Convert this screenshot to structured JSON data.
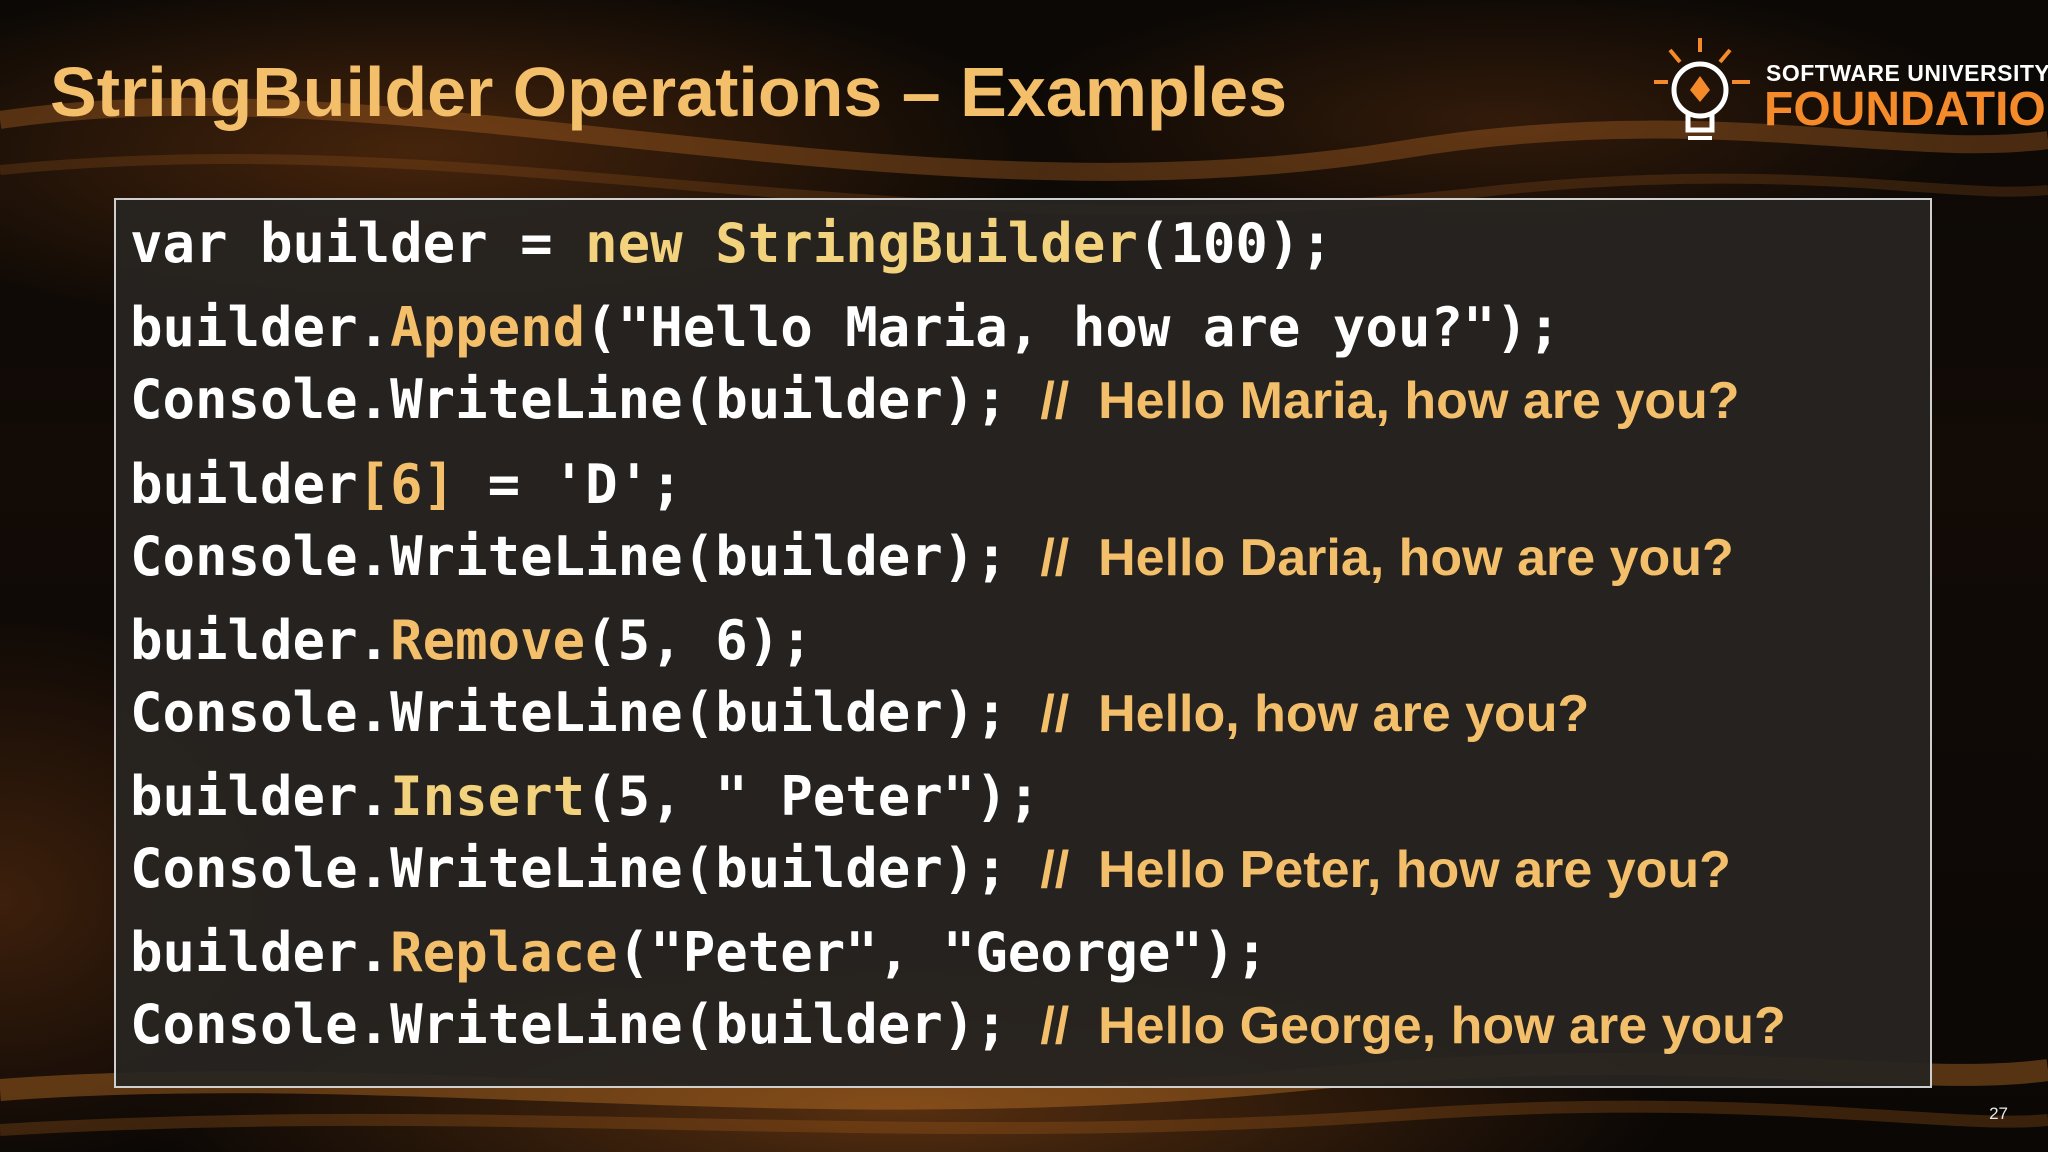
{
  "slide": {
    "title": "StringBuilder Operations – Examples",
    "page_number": "27"
  },
  "logo": {
    "line1": "SOFTWARE UNIVERSITY",
    "line2": "FOUNDATION"
  },
  "code": {
    "l1": {
      "a": "var builder = ",
      "b": "new StringBuilder",
      "c": "(100);"
    },
    "l2": {
      "a": "builder.",
      "b": "Append",
      "c": "(\"Hello Maria, how are you?\");"
    },
    "l3": {
      "a": "Console.WriteLine(builder); ",
      "b": "//  Hello Maria, how are you?"
    },
    "l4": {
      "a": "builder",
      "b": "[6]",
      "c": " = 'D';"
    },
    "l5": {
      "a": "Console.WriteLine(builder); ",
      "b": "//  Hello Daria, how are you?"
    },
    "l6": {
      "a": "builder.",
      "b": "Remove",
      "c": "(5, 6);"
    },
    "l7": {
      "a": "Console.WriteLine(builder); ",
      "b": "//  Hello, how are you?"
    },
    "l8": {
      "a": "builder.",
      "b": "Insert",
      "c": "(5, \" Peter\");"
    },
    "l9": {
      "a": "Console.WriteLine(builder); ",
      "b": "//  Hello Peter, how are you?"
    },
    "l10": {
      "a": "builder.",
      "b": "Replace",
      "c": "(\"Peter\", \"George\");"
    },
    "l11": {
      "a": "Console.WriteLine(builder); ",
      "b": "//  Hello George, how are you?"
    }
  },
  "colors": {
    "title": "#f3bf6a",
    "comment": "#f3bf6a",
    "keyword": "#f3d27e",
    "logo_accent": "#f58a2a",
    "code_text": "#ffffff"
  }
}
